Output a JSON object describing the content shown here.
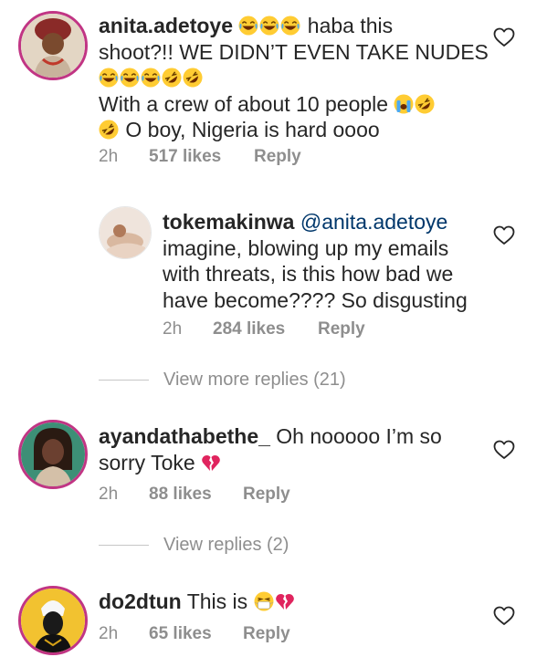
{
  "comments": [
    {
      "username": "anita.adetoye",
      "text_line1": "haba this",
      "text_line2": "shoot?!! WE DIDN’T EVEN TAKE NUDES",
      "text_line4": "With a crew of about 10 people",
      "text_line5": "O boy, Nigeria is hard oooo",
      "time": "2h",
      "likes": "517 likes",
      "reply": "Reply"
    },
    {
      "username": "tokemakinwa",
      "mention": "@anita.adetoye",
      "text_line2": "imagine, blowing up my emails",
      "text_line3": "with threats, is this how bad we",
      "text_line4": "have become???? So disgusting",
      "time": "2h",
      "likes": "284 likes",
      "reply": "Reply"
    },
    {
      "username": "ayandathabethe_",
      "text_line1": "Oh nooooo I’m so",
      "text_line2": "sorry Toke",
      "time": "2h",
      "likes": "88 likes",
      "reply": "Reply"
    },
    {
      "username": "do2dtun",
      "text_line1": "This is",
      "time": "2h",
      "likes": "65 likes",
      "reply": "Reply"
    }
  ],
  "view_more_replies": "View more replies (21)",
  "view_replies": "View replies (2)",
  "colors": {
    "text": "#262626",
    "secondary": "#8e8e8e",
    "mention": "#00376b",
    "story_ring": "#c13584"
  },
  "icons": {
    "like": "heart-outline-icon",
    "laughing": "face-with-tears-of-joy-emoji",
    "rofl": "rolling-on-the-floor-laughing-emoji",
    "crying": "loudly-crying-face-emoji",
    "broken_heart": "broken-heart-emoji",
    "mask": "face-with-medical-mask-emoji"
  }
}
